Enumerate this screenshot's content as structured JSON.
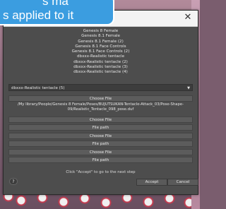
{
  "banner": {
    "line1": "s ma",
    "line2": "s applied to it"
  },
  "dialog": {
    "close_glyph": "✕",
    "list_items": [
      "Genesis 8 Female",
      "Genesis 8.1 Female",
      "Genesis 8.1 Female (2)",
      "Genesis 8.1 Face Controls",
      "Genesis 8.1 Face Controls (2)",
      "dbxxx-Realistic tentacle",
      "dbxxx-Realistic tentacle (2)",
      "dbxxx-Realistic tentacle (3)",
      "dbxxx-Realistic tentacle (4)"
    ],
    "dropdown_value": "dbxxx-Realistic tentacle (5)",
    "dropdown_arrow": "▼",
    "choose_file_1": "Choose File",
    "selected_path": "/My library/People/Genesis 8 Female/Poses/BUJUTSUKAN-Tentacle-Attack_03/Pose-Shape-09/Realistic_Tentacle_098_pose.duf",
    "choose_file_2": "Choose File",
    "file_path_2": "File path",
    "choose_file_3": "Choose File",
    "file_path_3": "File path",
    "choose_file_4": "Choose File",
    "file_path_4": "File path",
    "hint": "Click \"Accept\" to go to the next step",
    "help_label": "?",
    "accept_label": "Accept",
    "cancel_label": "Cancel"
  }
}
